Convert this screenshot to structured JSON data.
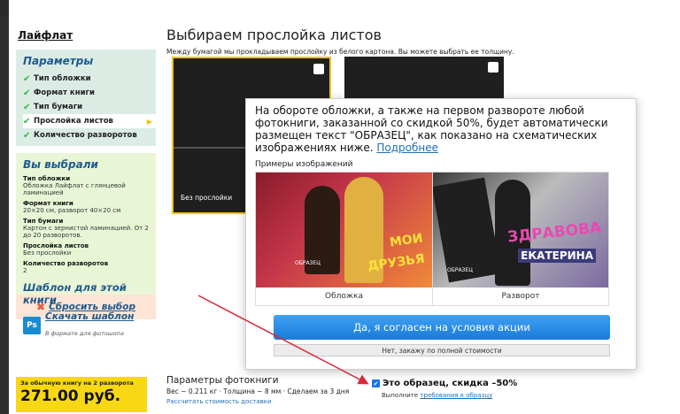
{
  "brand": "Лайфлат",
  "sidebar": {
    "params_title": "Параметры",
    "steps": [
      {
        "label": "Тип обложки"
      },
      {
        "label": "Формат книги"
      },
      {
        "label": "Тип бумаги"
      },
      {
        "label": "Прослойка листов"
      },
      {
        "label": "Количество разворотов"
      }
    ],
    "chosen_title": "Вы выбрали",
    "chosen": [
      {
        "title": "Тип обложки",
        "value": "Обложка Лайфлат с глянцевой ламинацией"
      },
      {
        "title": "Формат книги",
        "value": "20×20 см, разворот 40×20 см"
      },
      {
        "title": "Тип бумаги",
        "value": "Картон с зернистой ламинацией. От 2 до 20 разворотов."
      },
      {
        "title": "Прослойка листов",
        "value": "Без прослойки"
      },
      {
        "title": "Количество разворотов",
        "value": "2"
      }
    ],
    "template_title": "Шаблон для этой книги",
    "template_link": "Скачать шаблон",
    "template_sub": "В формате для фотошопа",
    "ps_label": "Ps",
    "reset_label": "Сбросить выбор"
  },
  "price": {
    "label": "За обычную книгу на 2 разворота",
    "value": "271.00 руб."
  },
  "main": {
    "title": "Выбираем прослойка листов",
    "subtitle": "Между бумагой мы прокладываем прослойку из белого картона. Вы можете выбрать ее толщину.",
    "thumb1_caption": "Без прослойки"
  },
  "params": {
    "title": "Параметры фотокниги",
    "line": "Вес ~ 0.211 кг · Толщина ~ 8 мм · Сделаем за 3 дня",
    "link": "Рассчитать стоимость доставки"
  },
  "sample": {
    "label": "Это образец, скидка –50%",
    "sub_prefix": "Выполните",
    "sub_link": "требования к образцу"
  },
  "popup": {
    "text": "На обороте обложки, а также на первом развороте любой фотокниги, заказанной со скидкой 50%, будет автоматически размещен текст \"ОБРАЗЕЦ\", как показано на схематических изображениях ниже.",
    "more_link": "Подробнее",
    "examples_label": "Примеры изображений",
    "cover_caption": "Обложка",
    "spread_caption": "Разворот",
    "cover_stamp": "ОБРАЗЕЦ",
    "cover_word1": "МОИ",
    "cover_word2": "ДРУЗЬЯ",
    "spread_stamp": "ОБРАЗЕЦ",
    "spread_name1": "ЗДРАВОВА",
    "spread_name2": "ЕКАТЕРИНА",
    "agree_label": "Да, я согласен на условия акции",
    "decline_label": "Нет, закажу по полной стоимости"
  },
  "colors": {
    "accent": "#1f5a8f",
    "button": "#1a7ad8",
    "price_bg": "#f8d812",
    "arrow": "#d8283a"
  }
}
